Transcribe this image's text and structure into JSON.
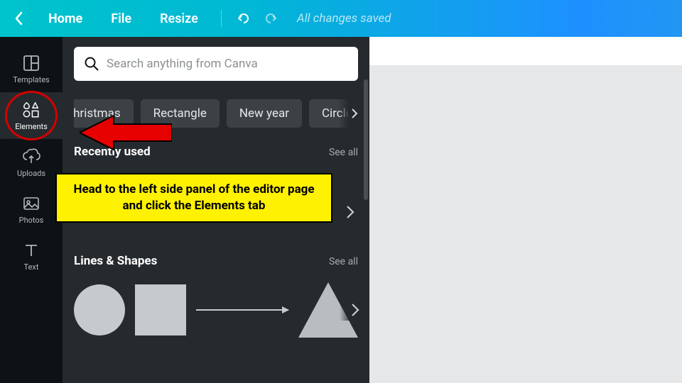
{
  "header": {
    "home": "Home",
    "file": "File",
    "resize": "Resize",
    "status": "All changes saved"
  },
  "sidebar": {
    "tabs": [
      {
        "id": "templates",
        "label": "Templates"
      },
      {
        "id": "elements",
        "label": "Elements"
      },
      {
        "id": "uploads",
        "label": "Uploads"
      },
      {
        "id": "photos",
        "label": "Photos"
      },
      {
        "id": "text",
        "label": "Text"
      }
    ]
  },
  "panel": {
    "search_placeholder": "Search anything from Canva",
    "chips": [
      "Christmas",
      "Rectangle",
      "New year",
      "Circle"
    ],
    "chips_visible_partial_first": "hristmas",
    "chips_visible_partial_last": "Circle",
    "sections": {
      "recently_used": {
        "title": "Recently used",
        "see_all": "See all"
      },
      "lines_shapes": {
        "title": "Lines & Shapes",
        "see_all": "See all"
      }
    }
  },
  "callout_text": "Head to the left side panel of the editor page and click the Elements tab",
  "colors": {
    "accent_start": "#00c4cc",
    "accent_end": "#2196f3",
    "panel_bg": "#252a2e",
    "sidebar_bg": "#0d1216",
    "callout_bg": "#fff200",
    "highlight_red": "#d50000"
  }
}
